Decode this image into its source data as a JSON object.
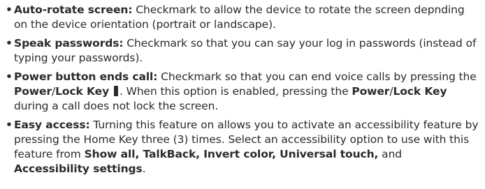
{
  "items": [
    {
      "term": "Auto-rotate screen:",
      "desc": " Checkmark to allow the device to rotate the screen depnding on the device orientation (portrait or landscape)."
    },
    {
      "term": "Speak passwords:",
      "desc": " Checkmark so that you can say your log in passwords (instead of typing your passwords)."
    },
    {
      "term": "Power button ends call:",
      "desc1": " Checkmark so that you can end voice calls by pressing the ",
      "key1a": "Power",
      "slash1": "/",
      "key1b": "Lock Key",
      "desc2": ". When this option is enabled, pressing the ",
      "key2a": "Power",
      "slash2": "/",
      "key2b": "Lock Key",
      "desc3": " during a call does not lock the screen.",
      "key_icon": "power-lock-key-icon"
    },
    {
      "term": "Easy access:",
      "desc1": " Turning this feature on allows you to activate an accessibility feature by pressing the Home Key three (3) times. Select an accessibility option to use with this feature from ",
      "opts": "Show all, TalkBack, Invert color, Universal touch,",
      "and": " and ",
      "opt_last": "Accessibility settings",
      "end": "."
    }
  ]
}
